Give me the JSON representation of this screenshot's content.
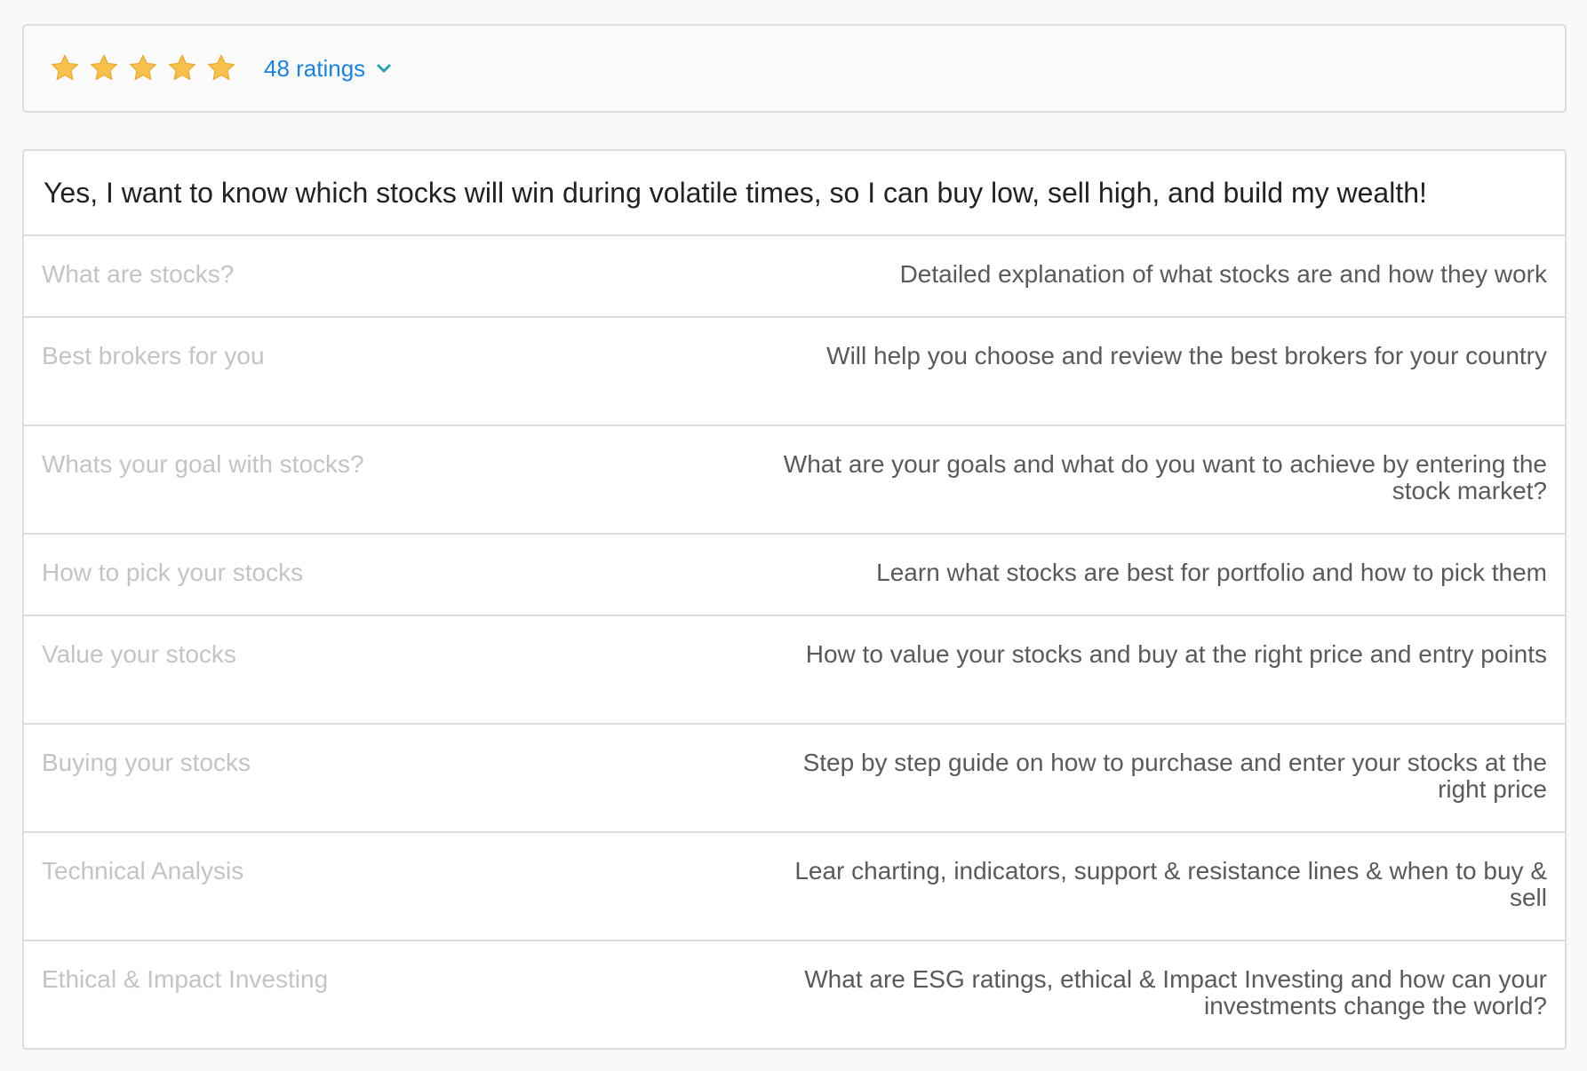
{
  "rating": {
    "stars_filled": 5,
    "stars_total": 5,
    "count_label": "48 ratings",
    "star_color": "#f7c04a",
    "link_color": "#1a82e2",
    "chevron_color": "#1fa3b5"
  },
  "headline": "Yes, I want to know which stocks will win during volatile times, so I can buy low, sell high, and build my wealth!",
  "rows": [
    {
      "title": "What are stocks?",
      "desc": "Detailed explanation of what stocks are and how they work"
    },
    {
      "title": "Best brokers for you",
      "desc": "Will help you choose and review the best brokers for your country"
    },
    {
      "title": "Whats your goal with stocks?",
      "desc": "What are your goals and what do you want to achieve by entering the stock market?"
    },
    {
      "title": "How to pick your stocks",
      "desc": "Learn what stocks are best for portfolio and how to pick them"
    },
    {
      "title": "Value your stocks",
      "desc": "How to value your stocks and buy at the right price and entry points"
    },
    {
      "title": "Buying your stocks",
      "desc": "Step by step guide on how to purchase and enter your stocks at the right price"
    },
    {
      "title": "Technical Analysis",
      "desc": "Lear charting, indicators, support & resistance lines & when to buy & sell"
    },
    {
      "title": "Ethical & Impact Investing",
      "desc": "What are ESG ratings, ethical & Impact Investing and how can your investments change the world?"
    }
  ]
}
